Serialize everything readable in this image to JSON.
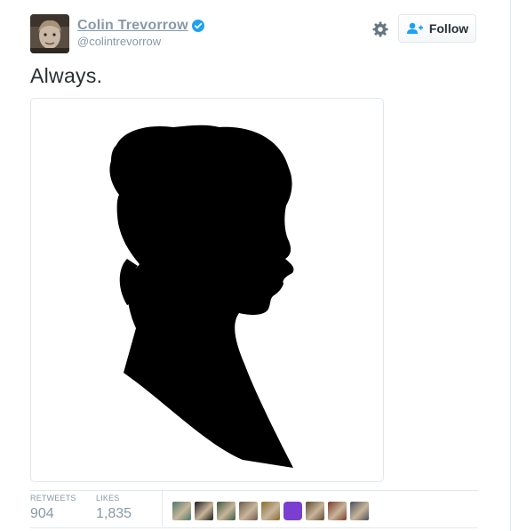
{
  "user": {
    "name": "Colin Trevorrow",
    "handle": "@colintrevorrow"
  },
  "actions": {
    "follow_label": "Follow"
  },
  "tweet": {
    "text": "Always."
  },
  "stats": {
    "retweets_label": "RETWEETS",
    "retweets_value": "904",
    "likes_label": "LIKES",
    "likes_value": "1,835"
  },
  "likers": [
    {
      "icon": "liker-avatar",
      "color": "#4c7a6a"
    },
    {
      "icon": "liker-avatar",
      "color": "#1a1a1a"
    },
    {
      "icon": "liker-avatar",
      "color": "#3d5a40"
    },
    {
      "icon": "liker-avatar",
      "color": "#6f5a4a"
    },
    {
      "icon": "liker-avatar",
      "color": "#8a6b2e"
    },
    {
      "icon": "liker-avatar",
      "color": "#7a3fd1"
    },
    {
      "icon": "liker-avatar",
      "color": "#5b4a2c"
    },
    {
      "icon": "liker-avatar",
      "color": "#7d3b2a"
    },
    {
      "icon": "liker-avatar",
      "color": "#4a4f5a"
    }
  ],
  "colors": {
    "accent": "#1da1f2",
    "muted": "#8899a6",
    "border": "#e1e8ed"
  }
}
